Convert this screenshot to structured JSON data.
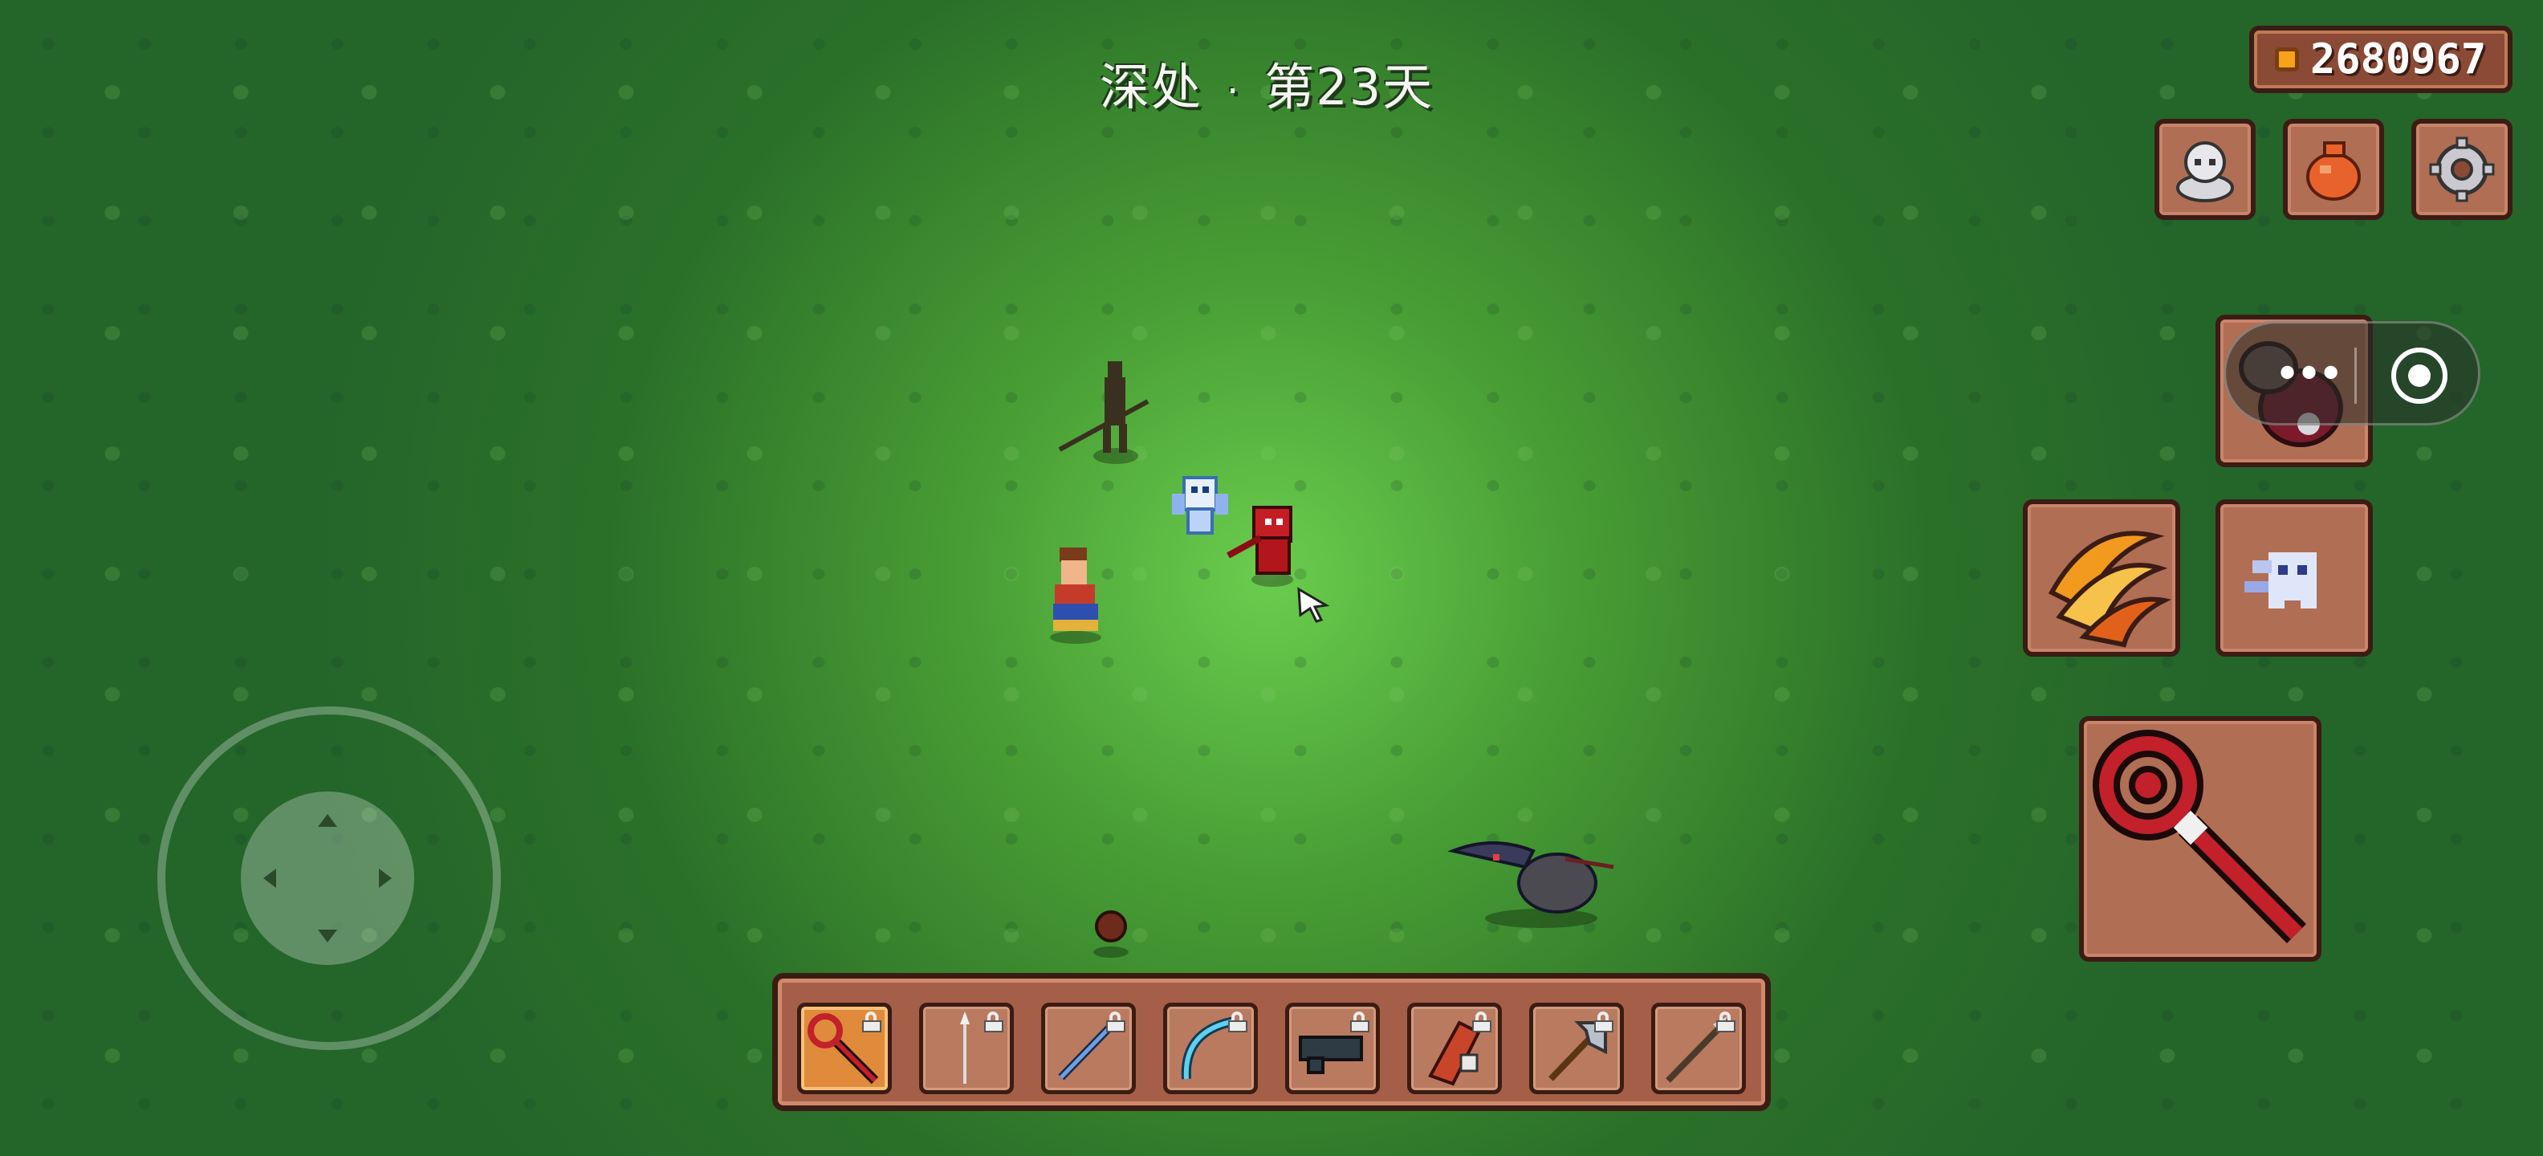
{
  "hud": {
    "location": "深处",
    "separator": "·",
    "day": "第23天",
    "coins": "2680967"
  },
  "top_buttons": [
    {
      "name": "character-icon"
    },
    {
      "name": "bag-icon"
    },
    {
      "name": "settings-gear-icon"
    }
  ],
  "skills": [
    {
      "name": "potion-skill"
    },
    {
      "name": "fire-claw-skill"
    },
    {
      "name": "ghost-dash-skill"
    }
  ],
  "main_weapon": {
    "name": "red-staff-weapon"
  },
  "hotbar": {
    "selected_index": 0,
    "slots": [
      {
        "item": "red-staff",
        "locked": true
      },
      {
        "item": "spear",
        "locked": true
      },
      {
        "item": "blue-sword",
        "locked": true
      },
      {
        "item": "ice-bow",
        "locked": true
      },
      {
        "item": "blaster-gun",
        "locked": true
      },
      {
        "item": "fire-gauntlet",
        "locked": true
      },
      {
        "item": "steel-axe",
        "locked": true
      },
      {
        "item": "battle-spear",
        "locked": true
      }
    ]
  },
  "colors": {
    "grass": "#24652a",
    "panel": "#b06e55",
    "panel_border": "#3b1c14",
    "coin": "#f7a21b"
  }
}
